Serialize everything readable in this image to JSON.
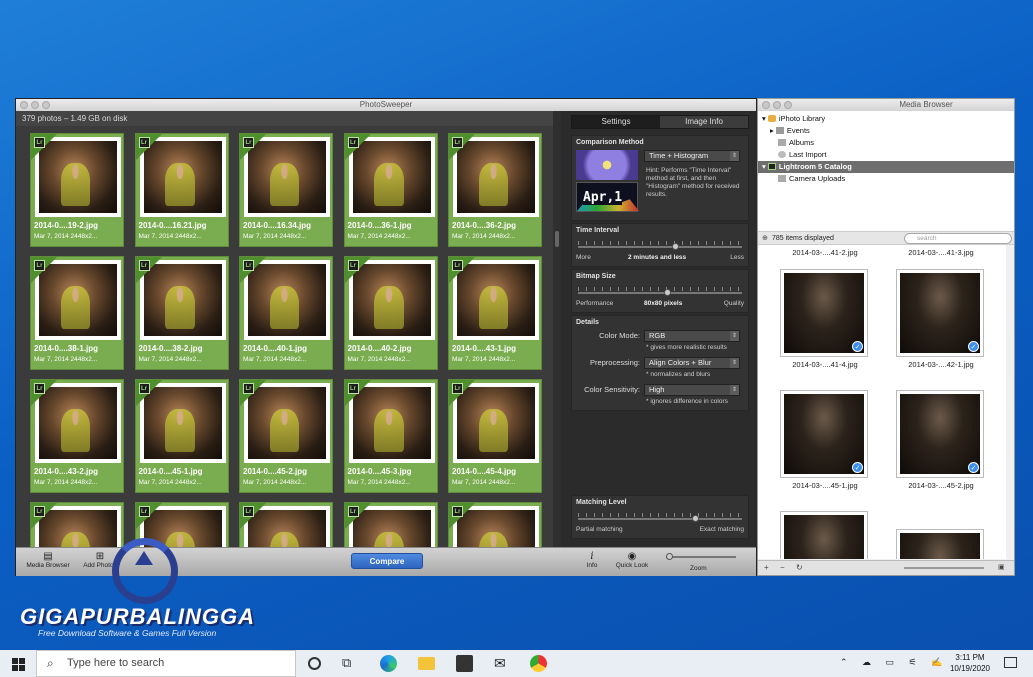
{
  "photosweeper": {
    "title": "PhotoSweeper",
    "status": "379 photos – 1.49 GB on disk",
    "cells": [
      {
        "name": "2014-0....19-2.jpg",
        "meta": "Mar 7, 2014   2448x2..."
      },
      {
        "name": "2014-0....16.21.jpg",
        "meta": "Mar 7, 2014   2448x2..."
      },
      {
        "name": "2014-0....16.34.jpg",
        "meta": "Mar 7, 2014   2448x2..."
      },
      {
        "name": "2014-0....36-1.jpg",
        "meta": "Mar 7, 2014   2448x2..."
      },
      {
        "name": "2014-0....36-2.jpg",
        "meta": "Mar 7, 2014   2448x2..."
      },
      {
        "name": "2014-0....38-1.jpg",
        "meta": "Mar 7, 2014   2448x2..."
      },
      {
        "name": "2014-0....38-2.jpg",
        "meta": "Mar 7, 2014   2448x2..."
      },
      {
        "name": "2014-0....40-1.jpg",
        "meta": "Mar 7, 2014   2448x2..."
      },
      {
        "name": "2014-0....40-2.jpg",
        "meta": "Mar 7, 2014   2448x2..."
      },
      {
        "name": "2014-0....43-1.jpg",
        "meta": "Mar 7, 2014   2448x2..."
      },
      {
        "name": "2014-0....43-2.jpg",
        "meta": "Mar 7, 2014   2448x2..."
      },
      {
        "name": "2014-0....45-1.jpg",
        "meta": "Mar 7, 2014   2448x2..."
      },
      {
        "name": "2014-0....45-2.jpg",
        "meta": "Mar 7, 2014   2448x2..."
      },
      {
        "name": "2014-0....45-3.jpg",
        "meta": "Mar 7, 2014   2448x2..."
      },
      {
        "name": "2014-0....45-4.jpg",
        "meta": "Mar 7, 2014   2448x2..."
      },
      {
        "name": "",
        "meta": ""
      },
      {
        "name": "",
        "meta": ""
      },
      {
        "name": "",
        "meta": ""
      },
      {
        "name": "",
        "meta": ""
      },
      {
        "name": "",
        "meta": ""
      }
    ],
    "lr_mark": "Lr",
    "settings": {
      "tabs": [
        "Settings",
        "Image Info"
      ],
      "comparison_title": "Comparison Method",
      "comparison_value": "Time + Histogram",
      "comparison_hint": "Hint: Performs \"Time Interval\" method at first, and then \"Histogram\" method for received results.",
      "calendar_text": "Apr,1",
      "time_title": "Time Interval",
      "time_left": "More",
      "time_value": "2 minutes and less",
      "time_right": "Less",
      "time_level": 0.6,
      "bitmap_title": "Bitmap Size",
      "bitmap_left": "Performance",
      "bitmap_value": "80x80 pixels",
      "bitmap_right": "Quality",
      "bitmap_level": 0.55,
      "details_title": "Details",
      "color_mode_label": "Color Mode:",
      "color_mode_value": "RGB",
      "color_mode_note": "* gives more realistic results",
      "preproc_label": "Preprocessing:",
      "preproc_value": "Align Colors + Blur",
      "preproc_note": "* normalizes and blurs",
      "sensitivity_label": "Color Sensitivity:",
      "sensitivity_value": "High",
      "sensitivity_note": "* ignores difference in colors",
      "matching_title": "Matching Level",
      "matching_left": "Partial matching",
      "matching_right": "Exact matching",
      "matching_level": 0.72
    },
    "toolbar": {
      "media_browser": "Media Browser",
      "add_photos": "Add Photos",
      "compare": "Compare",
      "info": "Info",
      "quick_look": "Quick Look",
      "zoom": "Zoom"
    }
  },
  "media_browser": {
    "title": "Media Browser",
    "tree": [
      "iPhoto Library",
      "Events",
      "Albums",
      "Last Import",
      "Lightroom 5 Catalog",
      "Camera Uploads"
    ],
    "count": "785 items displayed",
    "search_placeholder": "search",
    "items": [
      {
        "caption": "2014-03-....41-2.jpg"
      },
      {
        "caption": "2014-03-....41-3.jpg"
      },
      {
        "caption": "2014-03-....41-4.jpg"
      },
      {
        "caption": "2014-03-....42-1.jpg"
      },
      {
        "caption": "2014-03-....45-1.jpg"
      },
      {
        "caption": "2014-03-....45-2.jpg"
      }
    ]
  },
  "watermark": {
    "title": "GIGAPURBALINGGA",
    "subtitle": "Free Download Software & Games Full Version"
  },
  "taskbar": {
    "search_placeholder": "Type here to search",
    "time": "3:11 PM",
    "date": "10/19/2020"
  }
}
